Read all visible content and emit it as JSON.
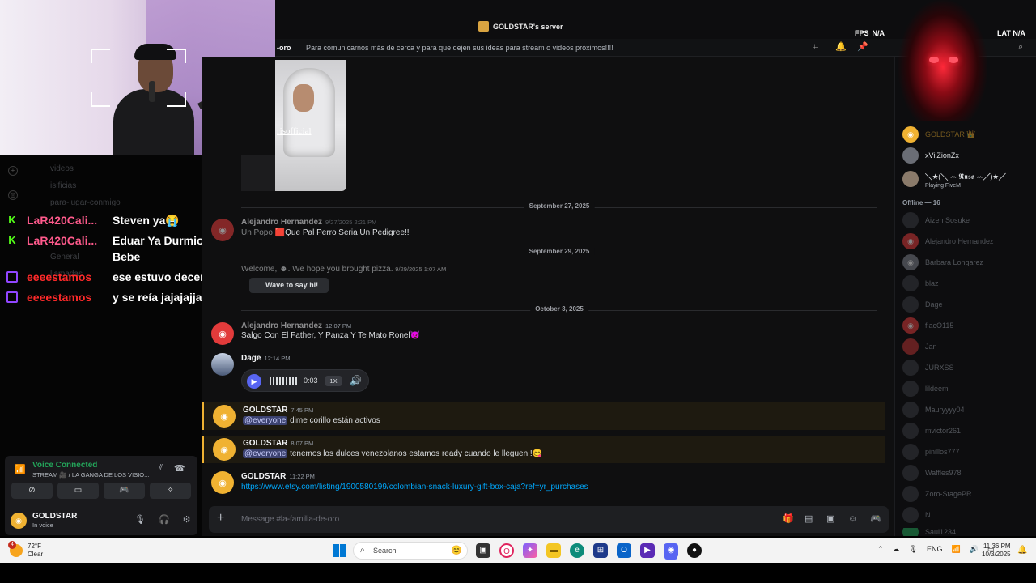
{
  "titlebar": {
    "server_name": "GOLDSTAR's server",
    "fps_label": "FPS",
    "fps_value": "N/A",
    "lat_label": "LAT",
    "lat_value": "N/A"
  },
  "channel": {
    "name_visible": "-oro",
    "topic": "Para comunicarnos más de cerca y para que dejen sus ideas para stream o videos próximos!!!!"
  },
  "sidebar_channels": [
    "videos",
    "isificias",
    "para-jugar-conmigo",
    "General",
    "llamadas"
  ],
  "stream_chat": [
    {
      "platform": "kick",
      "user": "LaR420Cali...",
      "message": "Steven ya😭"
    },
    {
      "platform": "kick",
      "user": "LaR420Cali...",
      "message": "Eduar Ya Durmio Como Un Bebe"
    },
    {
      "platform": "twitch",
      "user": "eeeestamos",
      "message": "ese estuvo decente"
    },
    {
      "platform": "twitch",
      "user": "eeeestamos",
      "message": "y se reía jajajajja"
    }
  ],
  "image_watermark": "risofficial",
  "dividers": [
    "September 27, 2025",
    "September 29, 2025",
    "October 3, 2025"
  ],
  "messages": {
    "m1": {
      "author": "Alejandro Hernandez",
      "time": "9/27/2025 2:21 PM",
      "text_prefix": "Un Popo",
      "text": "Que Pal Perro Seria Un Pedigree!!"
    },
    "m2": {
      "author": "Welcome,",
      "text": ". We hope you brought pizza.",
      "time": "9/29/2025 1:07 AM",
      "button": "Wave to say hi!"
    },
    "m3": {
      "author": "Alejandro Hernandez",
      "time": "12:07 PM",
      "text": "Salgo Con El Father, Y Panza Y Te Mato Ronel👿"
    },
    "m4": {
      "author": "Dage",
      "time": "12:14 PM",
      "duration": "0:03",
      "speed": "1X"
    },
    "m5": {
      "author": "GOLDSTAR",
      "time": "7:45 PM",
      "mention": "@everyone",
      "text": "dime corillo están activos"
    },
    "m6": {
      "author": "GOLDSTAR",
      "time": "8:07 PM",
      "mention": "@everyone",
      "text": "tenemos los dulces venezolanos estamos ready cuando le lleguen!!😋"
    },
    "m7": {
      "author": "GOLDSTAR",
      "time": "11:22 PM",
      "link": "https://www.etsy.com/listing/1900580199/colombian-snack-luxury-gift-box-caja?ref=yr_purchases"
    }
  },
  "composer": {
    "placeholder": "Message #la-familia-de-oro"
  },
  "voice_panel": {
    "status": "Voice Connected",
    "channel": "STREAM 🎥 / LA GANGA DE LOS VISIO...",
    "user": "GOLDSTAR",
    "user_status": "In voice"
  },
  "members": {
    "online": [
      {
        "name": "GOLDSTAR 👑",
        "avatar": "gold"
      },
      {
        "name": "xViiZionZx",
        "avatar": "photo"
      },
      {
        "name": "╲★(╲ ꕀ 𝕽𝖚𝖘𝖔 ꕀ╱)★╱",
        "activity": "Playing FiveM",
        "avatar": "photo"
      }
    ],
    "offline_label": "Offline — 16",
    "offline": [
      "Aizen Sosuke",
      "Alejandro Hernandez",
      "Barbara Longarez",
      "blaz",
      "Dage",
      "flacO115",
      "Jan",
      "JURXSS",
      "lildeem",
      "Mauryyyy04",
      "mvictor261",
      "pinillos777",
      "Waffles978",
      "Zoro-StagePR",
      "N",
      "Saul1234"
    ]
  },
  "taskbar": {
    "weather_badge": "4",
    "temp": "72°F",
    "condition": "Clear",
    "search_label": "Search",
    "lang": "ENG",
    "time": "11:36 PM",
    "date": "10/3/2025"
  },
  "colors": {
    "online": "#23a55a",
    "brand": "#5865f2",
    "gold": "#f0b232",
    "link": "#00a8fc"
  }
}
